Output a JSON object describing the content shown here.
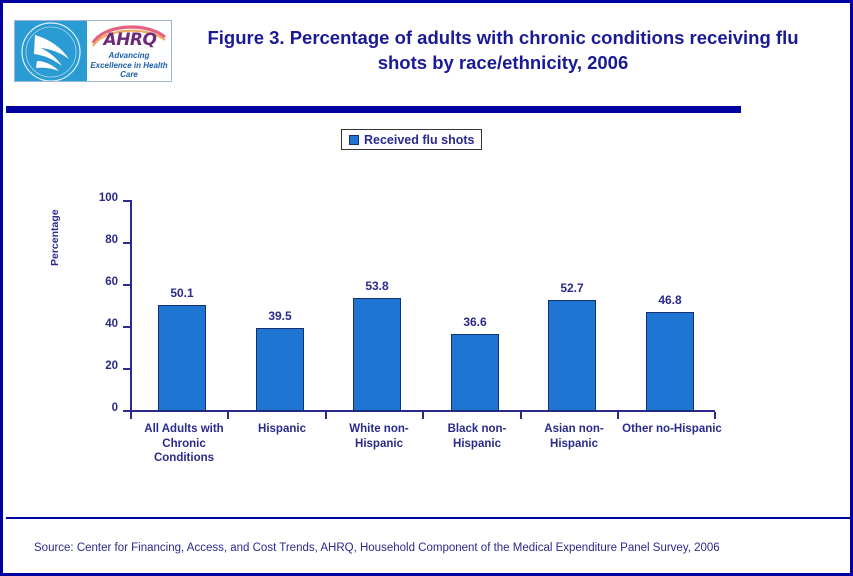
{
  "header": {
    "title": "Figure 3. Percentage of adults with chronic conditions receiving flu shots by race/ethnicity, 2006",
    "logo": {
      "seal_name": "hhs-seal",
      "wordmark": "AHRQ",
      "tagline": "Advancing Excellence in Health Care"
    }
  },
  "legend": {
    "items": [
      {
        "label": "Received flu shots",
        "color": "#1F76D2"
      }
    ]
  },
  "footer": {
    "source": "Source: Center for Financing, Access, and Cost Trends, AHRQ, Household Component of the Medical Expenditure Panel Survey, 2006"
  },
  "colors": {
    "bar_fill": "#1F76D2",
    "bar_border": "#15306E",
    "text_navy": "#2A2A8C",
    "page_border": "#0000A0",
    "title_blue": "#1A1A96"
  },
  "chart_data": {
    "type": "bar",
    "title": "Figure 3. Percentage of adults with chronic conditions receiving flu shots by race/ethnicity, 2006",
    "xlabel": "",
    "ylabel": "Percentage",
    "ylim": [
      0,
      100
    ],
    "yticks": [
      0,
      20,
      40,
      60,
      80,
      100
    ],
    "ytick_labels": [
      "0",
      "20",
      "40",
      "60",
      "80",
      "100"
    ],
    "grid": false,
    "legend_position": "top-center",
    "categories": [
      "All Adults with Chronic Conditions",
      "Hispanic",
      "White non-Hispanic",
      "Black non-Hispanic",
      "Asian non-Hispanic",
      "Other no-Hispanic"
    ],
    "series": [
      {
        "name": "Received flu shots",
        "color": "#1F76D2",
        "values": [
          50.1,
          39.5,
          53.8,
          36.6,
          52.7,
          46.8
        ],
        "value_labels": [
          "50.1",
          "39.5",
          "53.8",
          "36.6",
          "52.7",
          "46.8"
        ]
      }
    ]
  }
}
